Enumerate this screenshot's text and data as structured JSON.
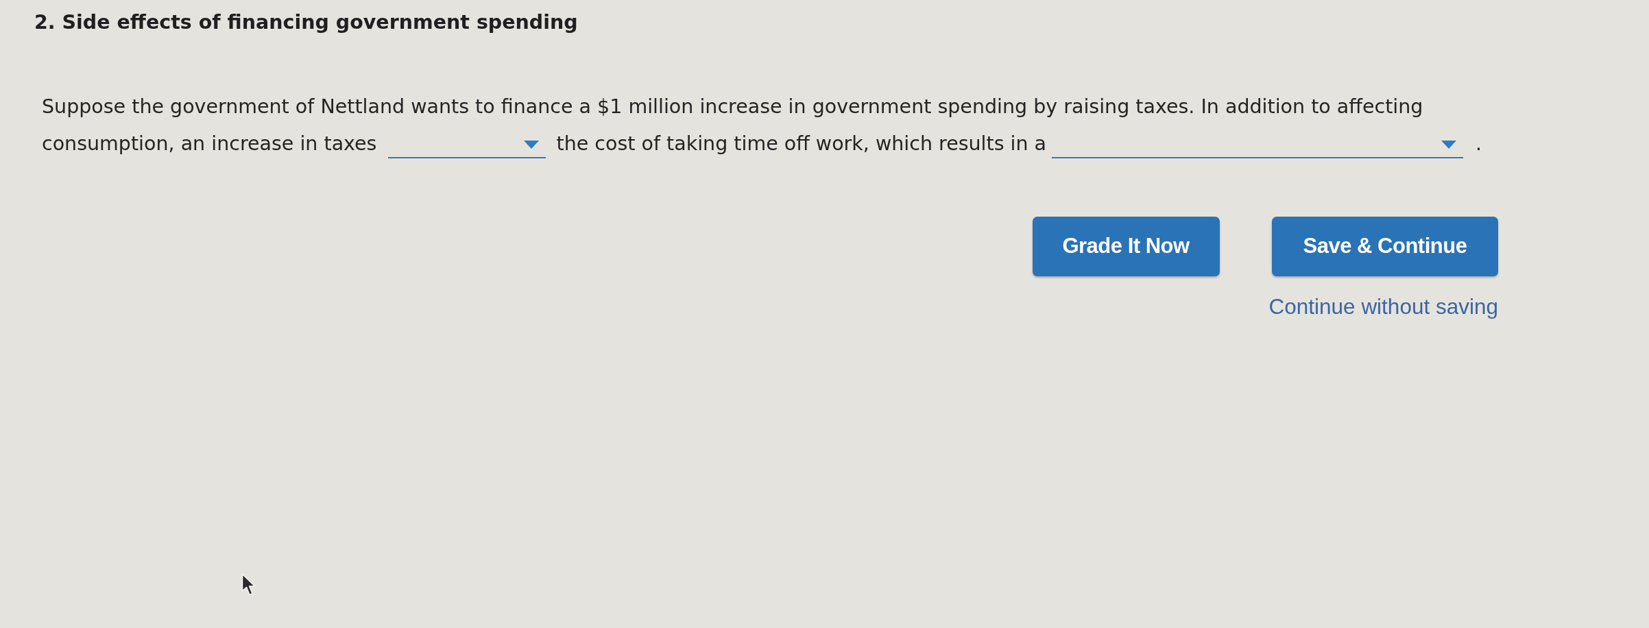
{
  "question": {
    "title": "2. Side effects of financing government spending",
    "lines": [
      [
        {
          "kind": "text",
          "text": "Suppose the government of Nettland wants to finance a $1 million increase in government spending by raising taxes. In addition to affecting"
        }
      ],
      [
        {
          "kind": "text",
          "text": "consumption, an increase in taxes"
        },
        {
          "kind": "dropdown"
        },
        {
          "kind": "text",
          "text": "the cost of taking time off work, which results in a"
        },
        {
          "kind": "dropdown"
        },
        {
          "kind": "text",
          "text": "."
        }
      ]
    ]
  },
  "actions": {
    "buttons": [
      "Grade It Now",
      "Save & Continue"
    ],
    "link": "Continue without saving"
  }
}
